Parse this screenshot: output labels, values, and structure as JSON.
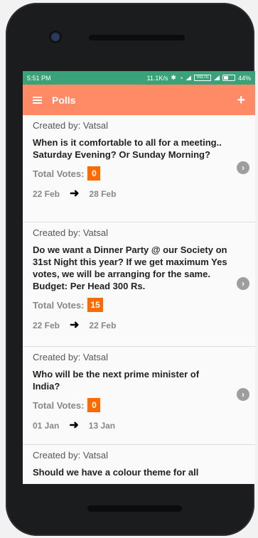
{
  "status_bar": {
    "time": "5:51 PM",
    "speed": "11.1K/s",
    "volte": "VoLTE",
    "battery": "44%"
  },
  "app_bar": {
    "title": "Polls"
  },
  "polls": [
    {
      "created": "Created by: Vatsal",
      "question": "When is it comfortable to all for a meeting.. Saturday Evening? Or Sunday Morning?",
      "votes_label": "Total Votes:",
      "votes": "0",
      "start": "22 Feb",
      "end": "28 Feb"
    },
    {
      "created": "Created by: Vatsal",
      "question": "Do we want a Dinner Party @ our Society on 31st Night this year? If we get maximum Yes votes, we will be arranging for the same. Budget: Per Head 300 Rs.",
      "votes_label": "Total Votes:",
      "votes": "15",
      "start": "22 Feb",
      "end": "22 Feb"
    },
    {
      "created": "Created by: Vatsal",
      "question": "Who will be the next prime minister of India?",
      "votes_label": "Total Votes:",
      "votes": "0",
      "start": "01 Jan",
      "end": "13 Jan"
    },
    {
      "created": "Created by: Vatsal",
      "question": "Should we have a colour theme for all"
    }
  ]
}
